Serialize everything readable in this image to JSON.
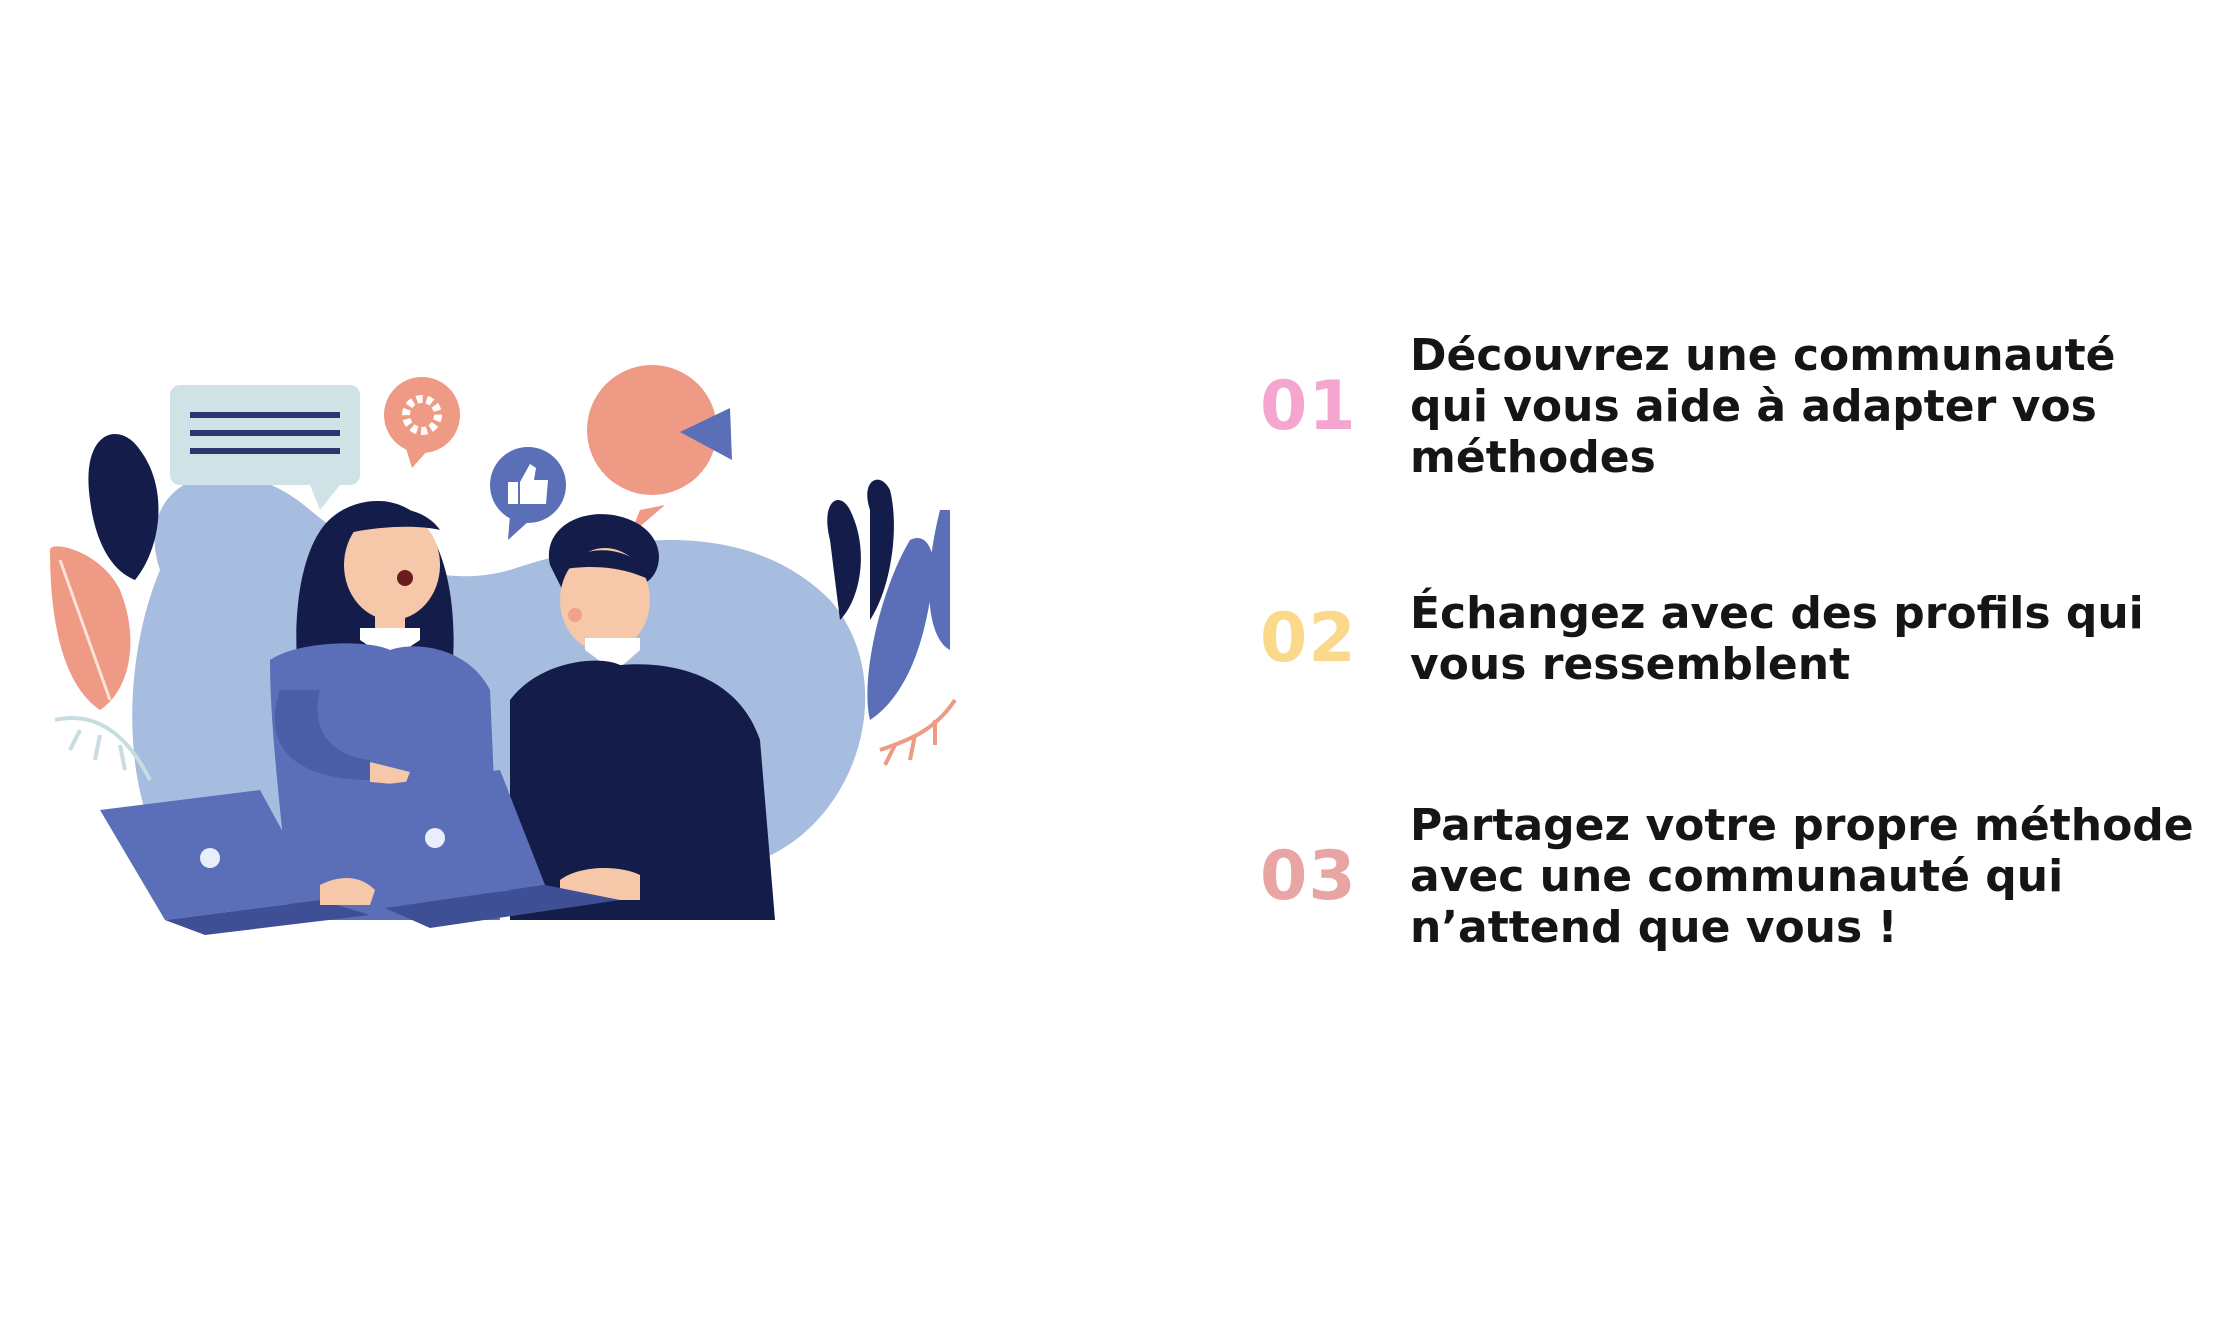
{
  "colors": {
    "background": "#ffffff",
    "num1": "#f4a6cf",
    "num2": "#fad98a",
    "num3": "#e9a4a4",
    "text": "#151515",
    "blob": "#a7bde0",
    "navy": "#141c4a",
    "blue": "#5a6fb8",
    "coral": "#ee9a84"
  },
  "illustration": {
    "icons": [
      "speech-bubble-icon",
      "gear-icon",
      "thumbs-up-icon",
      "pie-chart-icon",
      "laptop-icon"
    ]
  },
  "features": [
    {
      "number": "01",
      "text": "Découvrez une communauté\nqui vous aide à adapter vos\nméthodes"
    },
    {
      "number": "02",
      "text": "Échangez avec des profils qui\nvous ressemblent"
    },
    {
      "number": "03",
      "text": "Partagez votre propre méthode\navec une communauté qui\nn’attend que vous !"
    }
  ]
}
